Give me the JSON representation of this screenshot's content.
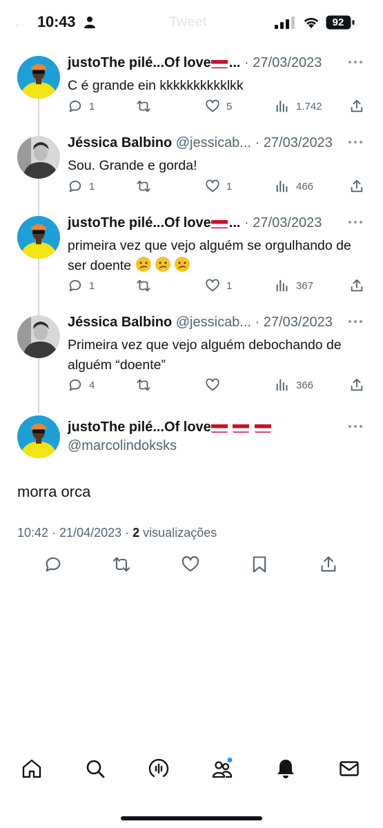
{
  "status_bar": {
    "time": "10:43",
    "battery": "92",
    "faded_title": "Tweet"
  },
  "colors": {
    "text": "#0f1419",
    "secondary": "#536471",
    "thread_line": "#cfd9de",
    "notification_dot": "#1d9bf0",
    "flag_red": "#c8102e"
  },
  "thread": [
    {
      "author": "justoThe pilé...Of love",
      "author_suffix": "...",
      "handle": "",
      "date": "27/03/2023",
      "text": "C é grande ein kkkkkkkkkklkk",
      "replies": "1",
      "retweets": "",
      "likes": "5",
      "views": "1.742",
      "avatar": "yellow-suit-avatar"
    },
    {
      "author": "Jéssica Balbino",
      "author_suffix": "",
      "handle": "@jessicab...",
      "date": "27/03/2023",
      "text": "Sou. Grande e gorda!",
      "replies": "1",
      "retweets": "",
      "likes": "1",
      "views": "466",
      "avatar": "grayscale-avatar"
    },
    {
      "author": "justoThe pilé...Of love",
      "author_suffix": "...",
      "handle": "",
      "date": "27/03/2023",
      "text": "primeira vez que vejo alguém se orgulhando de ser doente",
      "replies": "1",
      "retweets": "",
      "likes": "1",
      "views": "367",
      "avatar": "yellow-suit-avatar"
    },
    {
      "author": "Jéssica Balbino",
      "author_suffix": "",
      "handle": "@jessicab...",
      "date": "27/03/2023",
      "text": "Primeira vez que vejo alguém debochando de alguém “doente”",
      "replies": "4",
      "retweets": "",
      "likes": "",
      "views": "366",
      "avatar": "grayscale-avatar"
    }
  ],
  "separator": "·",
  "main_tweet": {
    "author": "justoThe pilé...Of love",
    "handle": "@marcolindoksks",
    "text": "morra orca",
    "time": "10:42 · 21/04/2023 ·",
    "view_count": "2",
    "view_label": "visualizações"
  },
  "tab_bar": [
    "home-icon",
    "search-icon",
    "spaces-icon",
    "communities-icon",
    "notifications-icon",
    "messages-icon"
  ]
}
